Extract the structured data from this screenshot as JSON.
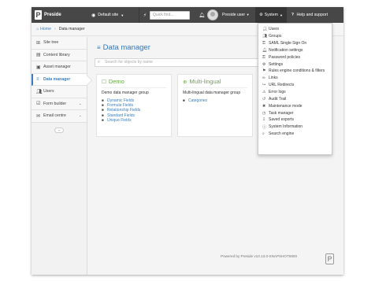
{
  "navbar": {
    "brand": "Preside",
    "site_selector": "Default site",
    "quickfind_placeholder": "Quick find...",
    "user": "Preside user",
    "system": "System",
    "help": "Help and support"
  },
  "breadcrumb": {
    "home": "Home",
    "current": "Data manager"
  },
  "sidebar": {
    "items": [
      {
        "label": "Site tree",
        "icon": "sitemap-icon"
      },
      {
        "label": "Content library",
        "icon": "library-icon"
      },
      {
        "label": "Asset manager",
        "icon": "asset-icon"
      },
      {
        "label": "Data manager",
        "icon": "database-icon"
      },
      {
        "label": "Users",
        "icon": "users-icon"
      },
      {
        "label": "Form builder",
        "icon": "form-icon"
      },
      {
        "label": "Email centre",
        "icon": "email-icon"
      }
    ]
  },
  "main": {
    "title": "Data manager",
    "search_placeholder": "Search for objects by name",
    "cards": [
      {
        "title": "Demo",
        "description": "Demo data manager group",
        "links": [
          "Dynamic Fields",
          "Formula Fields",
          "Relationship Fields",
          "Standard Fields",
          "Unique Fields"
        ]
      },
      {
        "title": "Multi-lingual",
        "description": "Multi-lingual data manager group",
        "links": [
          "Categories"
        ]
      }
    ]
  },
  "system_menu": {
    "items": [
      {
        "label": "Users",
        "icon": "user-icon"
      },
      {
        "label": "Groups",
        "icon": "group-icon"
      },
      {
        "label": "SAML Single Sign On",
        "icon": "key-icon"
      },
      {
        "label": "Notification settings",
        "icon": "bell-icon"
      },
      {
        "label": "Password policies",
        "icon": "key-icon"
      },
      {
        "label": "Settings",
        "icon": "cog-icon"
      },
      {
        "label": "Rules engine conditions & filters",
        "icon": "filter-icon"
      },
      {
        "label": "Links",
        "icon": "link-icon"
      },
      {
        "label": "URL Redirects",
        "icon": "redirect-icon"
      },
      {
        "label": "Error logs",
        "icon": "error-icon"
      },
      {
        "label": "Audit Trail",
        "icon": "history-icon"
      },
      {
        "label": "Maintenance mode",
        "icon": "tools-icon"
      },
      {
        "label": "Task manager",
        "icon": "clock-icon"
      },
      {
        "label": "Saved exports",
        "icon": "export-icon"
      },
      {
        "label": "System Information",
        "icon": "info-icon"
      },
      {
        "label": "Search engine",
        "icon": "search-icon"
      }
    ]
  },
  "footer": {
    "text": "Powered by Preside v10.13.0-SNAPSHOT6900"
  },
  "colors": {
    "navbar": "#474747",
    "link": "#3a7fc1",
    "card_title": "#69aa46"
  }
}
